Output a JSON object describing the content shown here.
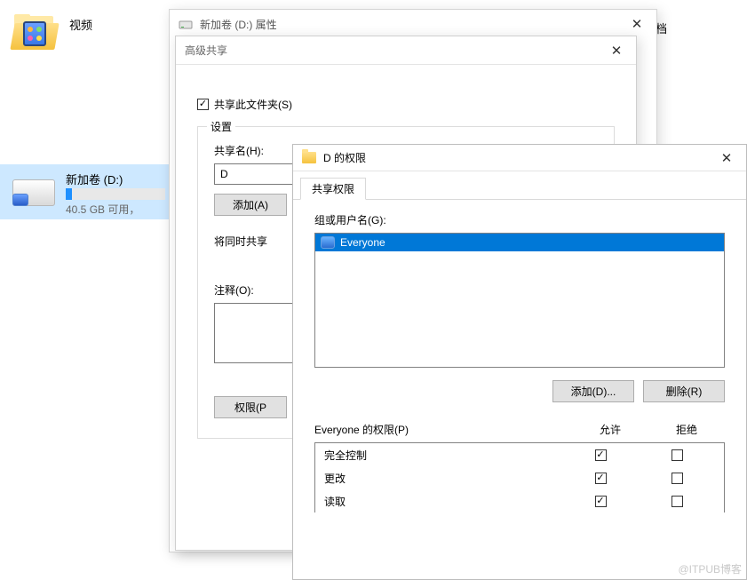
{
  "desktop": {
    "video_label": "视频",
    "topright_label": "档",
    "drive_title": "新加卷 (D:)",
    "drive_sub": "40.5 GB 可用，",
    "watermark": "@ITPUB博客"
  },
  "props": {
    "title": "新加卷 (D:) 属性"
  },
  "adv": {
    "title": "高级共享",
    "share_checkbox": "共享此文件夹(S)",
    "settings_legend": "设置",
    "share_name_label": "共享名(H):",
    "share_name_value": "D",
    "add_btn": "添加(A)",
    "limit_label": "将同时共享",
    "comment_label": "注释(O):",
    "perm_btn": "权限(P"
  },
  "perm": {
    "title": "D 的权限",
    "tab": "共享权限",
    "group_label": "组或用户名(G):",
    "users": [
      "Everyone"
    ],
    "add_btn": "添加(D)...",
    "remove_btn": "删除(R)",
    "perm_for_label": "Everyone 的权限(P)",
    "allow_label": "允许",
    "deny_label": "拒绝",
    "rows": [
      {
        "name": "完全控制",
        "allow": true,
        "deny": false
      },
      {
        "name": "更改",
        "allow": true,
        "deny": false
      },
      {
        "name": "读取",
        "allow": true,
        "deny": false
      }
    ]
  }
}
